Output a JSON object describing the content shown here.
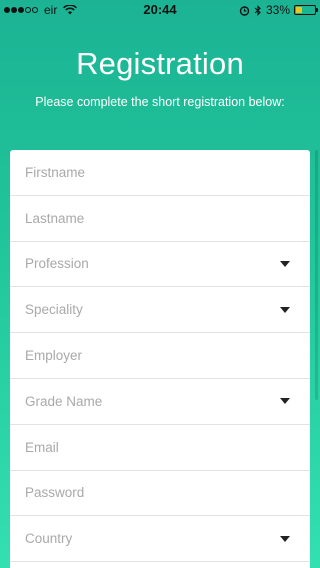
{
  "status_bar": {
    "carrier": "eir",
    "time": "20:44",
    "battery": "33%",
    "battery_level": 0.33,
    "battery_color": "#f2c318"
  },
  "header": {
    "title": "Registration",
    "subtitle": "Please complete the short registration below:"
  },
  "form": {
    "fields": [
      {
        "placeholder": "Firstname",
        "type": "text"
      },
      {
        "placeholder": "Lastname",
        "type": "text"
      },
      {
        "placeholder": "Profession",
        "type": "dropdown"
      },
      {
        "placeholder": "Speciality",
        "type": "dropdown"
      },
      {
        "placeholder": "Employer",
        "type": "text"
      },
      {
        "placeholder": "Grade Name",
        "type": "dropdown"
      },
      {
        "placeholder": "Email",
        "type": "text"
      },
      {
        "placeholder": "Password",
        "type": "text"
      },
      {
        "placeholder": "Country",
        "type": "dropdown"
      }
    ]
  },
  "colors": {
    "gradient_top": "#1bb394",
    "gradient_bottom": "#33e0b2"
  }
}
